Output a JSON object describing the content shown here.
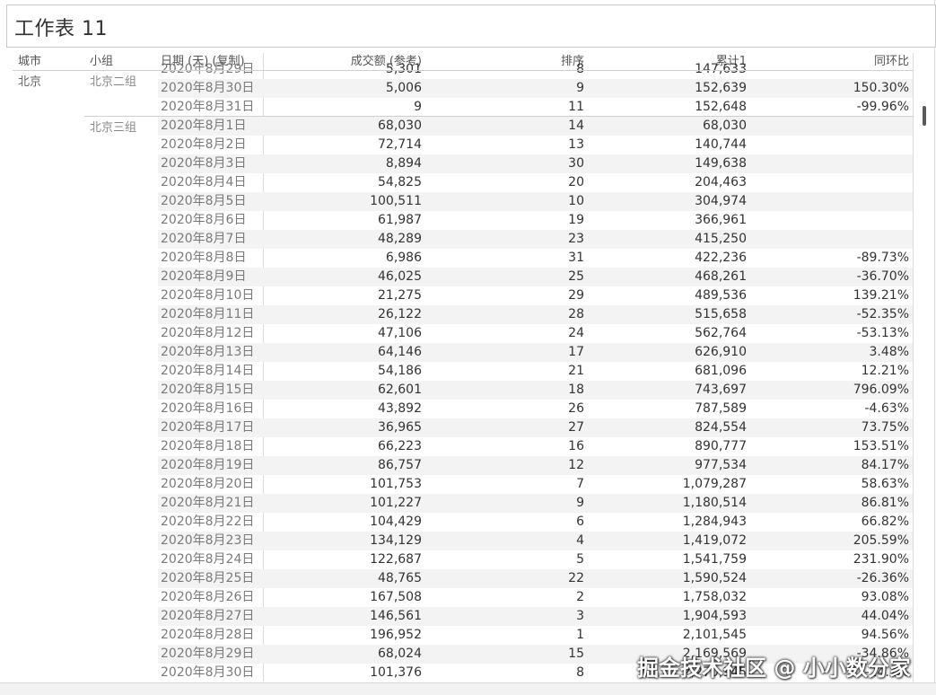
{
  "sheet": {
    "title": "工作表 11"
  },
  "columns": {
    "city": "城市",
    "group": "小组",
    "date": "日期 (天) (复制)",
    "amount": "成交额 (参考)",
    "rank": "排序",
    "cumulative": "累计1",
    "yoy": "同环比"
  },
  "city_label": "北京",
  "groups": {
    "g2": "北京二组",
    "g3": "北京三组"
  },
  "rows": [
    {
      "date": "2020年8月29日",
      "amount": "5,301",
      "rank": "8",
      "cum": "147,633",
      "yoy": ""
    },
    {
      "date": "2020年8月30日",
      "amount": "5,006",
      "rank": "9",
      "cum": "152,639",
      "yoy": "150.30%"
    },
    {
      "date": "2020年8月31日",
      "amount": "9",
      "rank": "11",
      "cum": "152,648",
      "yoy": "-99.96%"
    },
    {
      "date": "2020年8月1日",
      "amount": "68,030",
      "rank": "14",
      "cum": "68,030",
      "yoy": ""
    },
    {
      "date": "2020年8月2日",
      "amount": "72,714",
      "rank": "13",
      "cum": "140,744",
      "yoy": ""
    },
    {
      "date": "2020年8月3日",
      "amount": "8,894",
      "rank": "30",
      "cum": "149,638",
      "yoy": ""
    },
    {
      "date": "2020年8月4日",
      "amount": "54,825",
      "rank": "20",
      "cum": "204,463",
      "yoy": ""
    },
    {
      "date": "2020年8月5日",
      "amount": "100,511",
      "rank": "10",
      "cum": "304,974",
      "yoy": ""
    },
    {
      "date": "2020年8月6日",
      "amount": "61,987",
      "rank": "19",
      "cum": "366,961",
      "yoy": ""
    },
    {
      "date": "2020年8月7日",
      "amount": "48,289",
      "rank": "23",
      "cum": "415,250",
      "yoy": ""
    },
    {
      "date": "2020年8月8日",
      "amount": "6,986",
      "rank": "31",
      "cum": "422,236",
      "yoy": "-89.73%"
    },
    {
      "date": "2020年8月9日",
      "amount": "46,025",
      "rank": "25",
      "cum": "468,261",
      "yoy": "-36.70%"
    },
    {
      "date": "2020年8月10日",
      "amount": "21,275",
      "rank": "29",
      "cum": "489,536",
      "yoy": "139.21%"
    },
    {
      "date": "2020年8月11日",
      "amount": "26,122",
      "rank": "28",
      "cum": "515,658",
      "yoy": "-52.35%"
    },
    {
      "date": "2020年8月12日",
      "amount": "47,106",
      "rank": "24",
      "cum": "562,764",
      "yoy": "-53.13%"
    },
    {
      "date": "2020年8月13日",
      "amount": "64,146",
      "rank": "17",
      "cum": "626,910",
      "yoy": "3.48%"
    },
    {
      "date": "2020年8月14日",
      "amount": "54,186",
      "rank": "21",
      "cum": "681,096",
      "yoy": "12.21%"
    },
    {
      "date": "2020年8月15日",
      "amount": "62,601",
      "rank": "18",
      "cum": "743,697",
      "yoy": "796.09%"
    },
    {
      "date": "2020年8月16日",
      "amount": "43,892",
      "rank": "26",
      "cum": "787,589",
      "yoy": "-4.63%"
    },
    {
      "date": "2020年8月17日",
      "amount": "36,965",
      "rank": "27",
      "cum": "824,554",
      "yoy": "73.75%"
    },
    {
      "date": "2020年8月18日",
      "amount": "66,223",
      "rank": "16",
      "cum": "890,777",
      "yoy": "153.51%"
    },
    {
      "date": "2020年8月19日",
      "amount": "86,757",
      "rank": "12",
      "cum": "977,534",
      "yoy": "84.17%"
    },
    {
      "date": "2020年8月20日",
      "amount": "101,753",
      "rank": "7",
      "cum": "1,079,287",
      "yoy": "58.63%"
    },
    {
      "date": "2020年8月21日",
      "amount": "101,227",
      "rank": "9",
      "cum": "1,180,514",
      "yoy": "86.81%"
    },
    {
      "date": "2020年8月22日",
      "amount": "104,429",
      "rank": "6",
      "cum": "1,284,943",
      "yoy": "66.82%"
    },
    {
      "date": "2020年8月23日",
      "amount": "134,129",
      "rank": "4",
      "cum": "1,419,072",
      "yoy": "205.59%"
    },
    {
      "date": "2020年8月24日",
      "amount": "122,687",
      "rank": "5",
      "cum": "1,541,759",
      "yoy": "231.90%"
    },
    {
      "date": "2020年8月25日",
      "amount": "48,765",
      "rank": "22",
      "cum": "1,590,524",
      "yoy": "-26.36%"
    },
    {
      "date": "2020年8月26日",
      "amount": "167,508",
      "rank": "2",
      "cum": "1,758,032",
      "yoy": "93.08%"
    },
    {
      "date": "2020年8月27日",
      "amount": "146,561",
      "rank": "3",
      "cum": "1,904,593",
      "yoy": "44.04%"
    },
    {
      "date": "2020年8月28日",
      "amount": "196,952",
      "rank": "1",
      "cum": "2,101,545",
      "yoy": "94.56%"
    },
    {
      "date": "2020年8月29日",
      "amount": "68,024",
      "rank": "15",
      "cum": "2,169,569",
      "yoy": "-34.86%"
    },
    {
      "date": "2020年8月30日",
      "amount": "101,376",
      "rank": "8",
      "cum": "2,270,945",
      "yoy": "-24.2%"
    }
  ],
  "watermark": "掘金技术社区 @ 小小数分家"
}
